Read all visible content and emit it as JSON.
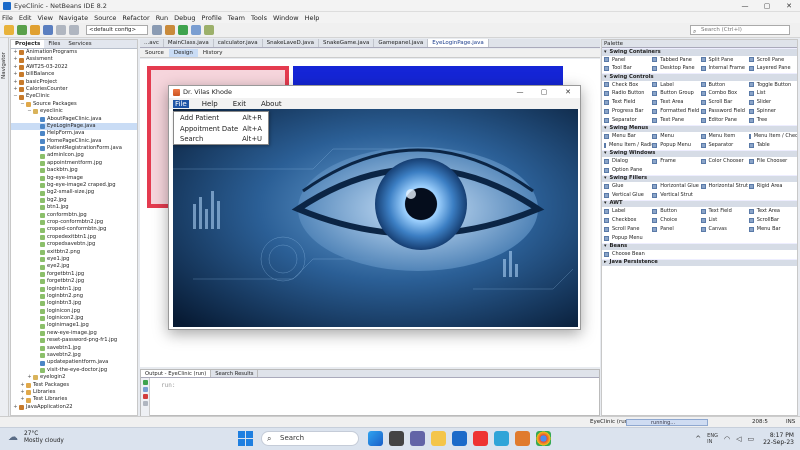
{
  "window": {
    "title": "EyeClinic - NetBeans IDE 8.2",
    "min": "—",
    "max": "▢",
    "close": "✕"
  },
  "menubar": [
    "File",
    "Edit",
    "View",
    "Navigate",
    "Source",
    "Refactor",
    "Run",
    "Debug",
    "Profile",
    "Team",
    "Tools",
    "Window",
    "Help"
  ],
  "toolbar": {
    "config": "<default config>",
    "search_placeholder": "Search (Ctrl+I)"
  },
  "navigator_label": "Navigator",
  "projects": {
    "tabs": [
      "Projects",
      "Files",
      "Services"
    ],
    "tree": [
      {
        "label": "AnimationPrograms",
        "indent": 0,
        "toggle": "+",
        "kind": "project"
      },
      {
        "label": "Assisment",
        "indent": 0,
        "toggle": "+",
        "kind": "project"
      },
      {
        "label": "AWT25-03-2022",
        "indent": 0,
        "toggle": "+",
        "kind": "project"
      },
      {
        "label": "billBalance",
        "indent": 0,
        "toggle": "+",
        "kind": "project"
      },
      {
        "label": "basicProject",
        "indent": 0,
        "toggle": "+",
        "kind": "project"
      },
      {
        "label": "CaloriesCounter",
        "indent": 0,
        "toggle": "+",
        "kind": "project"
      },
      {
        "label": "EyeClinic",
        "indent": 0,
        "toggle": "−",
        "kind": "project"
      },
      {
        "label": "Source Packages",
        "indent": 1,
        "toggle": "−",
        "kind": "folder"
      },
      {
        "label": "eyeclinic",
        "indent": 2,
        "toggle": "−",
        "kind": "package"
      },
      {
        "label": "AboutPageClinic.java",
        "indent": 3,
        "toggle": "",
        "kind": "java"
      },
      {
        "label": "EyeLoginPage.java",
        "indent": 3,
        "toggle": "",
        "kind": "java",
        "selected": true
      },
      {
        "label": "HelpForm.java",
        "indent": 3,
        "toggle": "",
        "kind": "java"
      },
      {
        "label": "HomePageClinic.java",
        "indent": 3,
        "toggle": "",
        "kind": "java"
      },
      {
        "label": "PatientRegistrationForm.java",
        "indent": 3,
        "toggle": "",
        "kind": "java"
      },
      {
        "label": "adminIcon.jpg",
        "indent": 3,
        "toggle": "",
        "kind": "img"
      },
      {
        "label": "appointmentform.jpg",
        "indent": 3,
        "toggle": "",
        "kind": "img"
      },
      {
        "label": "backbtn.jpg",
        "indent": 3,
        "toggle": "",
        "kind": "img"
      },
      {
        "label": "bg-eye-image",
        "indent": 3,
        "toggle": "",
        "kind": "img"
      },
      {
        "label": "bg-eye-image2 craped.jpg",
        "indent": 3,
        "toggle": "",
        "kind": "img"
      },
      {
        "label": "bg2-small-size.jpg",
        "indent": 3,
        "toggle": "",
        "kind": "img"
      },
      {
        "label": "bg2.jpg",
        "indent": 3,
        "toggle": "",
        "kind": "img"
      },
      {
        "label": "btn1.jpg",
        "indent": 3,
        "toggle": "",
        "kind": "img"
      },
      {
        "label": "conformbtn.jpg",
        "indent": 3,
        "toggle": "",
        "kind": "img"
      },
      {
        "label": "crop-conformbtn2.jpg",
        "indent": 3,
        "toggle": "",
        "kind": "img"
      },
      {
        "label": "croped-conformbtn.jpg",
        "indent": 3,
        "toggle": "",
        "kind": "img"
      },
      {
        "label": "cropedexitbtn1.jpg",
        "indent": 3,
        "toggle": "",
        "kind": "img"
      },
      {
        "label": "cropedsavebtn.jpg",
        "indent": 3,
        "toggle": "",
        "kind": "img"
      },
      {
        "label": "exitbtn2.png",
        "indent": 3,
        "toggle": "",
        "kind": "img"
      },
      {
        "label": "eye1.jpg",
        "indent": 3,
        "toggle": "",
        "kind": "img"
      },
      {
        "label": "eye2.jpg",
        "indent": 3,
        "toggle": "",
        "kind": "img"
      },
      {
        "label": "forgetbtn1.jpg",
        "indent": 3,
        "toggle": "",
        "kind": "img"
      },
      {
        "label": "forgetbtn2.jpg",
        "indent": 3,
        "toggle": "",
        "kind": "img"
      },
      {
        "label": "loginbtn1.jpg",
        "indent": 3,
        "toggle": "",
        "kind": "img"
      },
      {
        "label": "loginbtn2.png",
        "indent": 3,
        "toggle": "",
        "kind": "img"
      },
      {
        "label": "loginbtn3.jpg",
        "indent": 3,
        "toggle": "",
        "kind": "img"
      },
      {
        "label": "loginicon.jpg",
        "indent": 3,
        "toggle": "",
        "kind": "img"
      },
      {
        "label": "loginicon2.jpg",
        "indent": 3,
        "toggle": "",
        "kind": "img"
      },
      {
        "label": "loginimage1.jpg",
        "indent": 3,
        "toggle": "",
        "kind": "img"
      },
      {
        "label": "new-eye-image.jpg",
        "indent": 3,
        "toggle": "",
        "kind": "img"
      },
      {
        "label": "reset-password-png-fr1.jpg",
        "indent": 3,
        "toggle": "",
        "kind": "img"
      },
      {
        "label": "savebtn1.jpg",
        "indent": 3,
        "toggle": "",
        "kind": "img"
      },
      {
        "label": "savebtn2.jpg",
        "indent": 3,
        "toggle": "",
        "kind": "img"
      },
      {
        "label": "updatepatientform.java",
        "indent": 3,
        "toggle": "",
        "kind": "java"
      },
      {
        "label": "visit-the-eye-doctor.jpg",
        "indent": 3,
        "toggle": "",
        "kind": "img"
      },
      {
        "label": "eyelogin2",
        "indent": 2,
        "toggle": "+",
        "kind": "package"
      },
      {
        "label": "Test Packages",
        "indent": 1,
        "toggle": "+",
        "kind": "folder"
      },
      {
        "label": "Libraries",
        "indent": 1,
        "toggle": "+",
        "kind": "folder"
      },
      {
        "label": "Test Libraries",
        "indent": 1,
        "toggle": "+",
        "kind": "folder"
      },
      {
        "label": "JavaApplication22",
        "indent": 0,
        "toggle": "+",
        "kind": "project"
      }
    ]
  },
  "editor": {
    "tabs": [
      "...avc",
      "MainClass.java",
      "calculator.java",
      "SnakeLaveD.java",
      "SnakeGame.java",
      "Gamepanel.java",
      "EyeLoginPage.java"
    ],
    "active_tab": 6,
    "subtabs": [
      "Source",
      "Design",
      "History"
    ],
    "active_subtab": 1
  },
  "app_window": {
    "title": "Dr. Vilas Khode",
    "menu": [
      "File",
      "Help",
      "Exit",
      "About"
    ],
    "min": "—",
    "max": "▢",
    "close": "✕",
    "dropdown": [
      {
        "label": "Add Patient",
        "shortcut": "Alt+R"
      },
      {
        "label": "Appoitment Date",
        "shortcut": "Alt+A"
      },
      {
        "label": "Search",
        "shortcut": "Alt+U"
      }
    ]
  },
  "output": {
    "tabs": [
      "Output - EyeClinic (run)",
      "Search Results"
    ],
    "text": "run:"
  },
  "palette": {
    "tab": "Palette",
    "categories": [
      {
        "name": "Swing Containers",
        "items": [
          "Panel",
          "Tabbed Pane",
          "Split Pane",
          "Scroll Pane",
          "Tool Bar",
          "Desktop Pane",
          "Internal Frame",
          "Layered Pane"
        ]
      },
      {
        "name": "Swing Controls",
        "items": [
          "Check Box",
          "Label",
          "Button",
          "Toggle Button",
          "Radio Button",
          "Button Group",
          "Combo Box",
          "List",
          "Text Field",
          "Text Area",
          "Scroll Bar",
          "Slider",
          "Progress Bar",
          "Formatted Field",
          "Password Field",
          "Spinner",
          "Separator",
          "Text Pane",
          "Editor Pane",
          "Tree"
        ]
      },
      {
        "name": "Swing Menus",
        "items": [
          "Menu Bar",
          "Menu",
          "Menu Item",
          "Menu Item / CheckBox",
          "Menu Item / RadioButton",
          "Popup Menu",
          "Separator",
          "Table"
        ]
      },
      {
        "name": "Swing Windows",
        "items": [
          "Dialog",
          "Frame",
          "Color Chooser",
          "File Chooser",
          "Option Pane"
        ]
      },
      {
        "name": "Swing Fillers",
        "items": [
          "Glue",
          "Horizontal Glue",
          "Horizontal Strut",
          "Rigid Area",
          "Vertical Glue",
          "Vertical Strut"
        ]
      },
      {
        "name": "AWT",
        "items": [
          "Label",
          "Button",
          "Text Field",
          "Text Area",
          "Checkbox",
          "Choice",
          "List",
          "ScrollBar",
          "Scroll Pane",
          "Panel",
          "Canvas",
          "Menu Bar",
          "Popup Menu"
        ]
      },
      {
        "name": "Beans",
        "items": [
          "Choose Bean"
        ]
      },
      {
        "name": "Java Persistence",
        "items": []
      }
    ]
  },
  "statusbar": {
    "project": "EyeClinic (run)",
    "progress": "running...",
    "position": "208:5",
    "mode": "INS"
  },
  "taskbar": {
    "temp": "27°C",
    "weather": "Mostly cloudy",
    "search": "Search",
    "time": "8:17 PM",
    "date": "22-Sep-23",
    "lang": "ENG\nIN",
    "colors": {
      "start": "#1e7fe0"
    }
  }
}
